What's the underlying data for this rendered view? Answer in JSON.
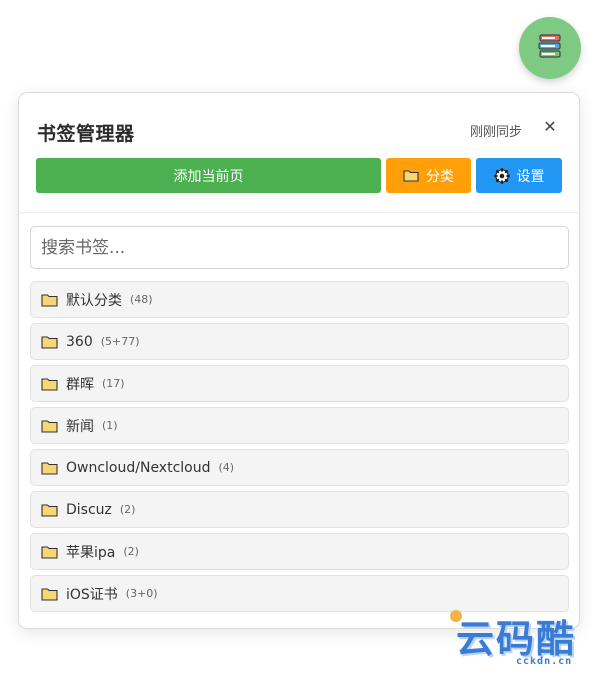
{
  "header": {
    "title": "书签管理器",
    "sync_status": "刚刚同步",
    "close_label": "✕"
  },
  "toolbar": {
    "add_label": "添加当前页",
    "category_label": "分类",
    "settings_label": "设置"
  },
  "search": {
    "placeholder": "搜索书签..."
  },
  "categories": [
    {
      "name": "默认分类",
      "count": "(48)"
    },
    {
      "name": "360",
      "count": "(5+77)"
    },
    {
      "name": "群晖",
      "count": "(17)"
    },
    {
      "name": "新闻",
      "count": "(1)"
    },
    {
      "name": "Owncloud/Nextcloud",
      "count": "(4)"
    },
    {
      "name": "Discuz",
      "count": "(2)"
    },
    {
      "name": "苹果ipa",
      "count": "(2)"
    },
    {
      "name": "iOS证书",
      "count": "(3+0)"
    }
  ],
  "watermark": {
    "text": "云码酷",
    "domain": "cckdn.cn"
  },
  "colors": {
    "accent_green": "#4caf50",
    "accent_orange": "#ff9f0a",
    "accent_blue": "#2196f3",
    "fab_green": "#7fca83",
    "folder_yellow": "#f7d774"
  },
  "icons": {
    "fab": "books-icon",
    "category_button": "folder-icon",
    "settings_button": "gear-icon",
    "list_item": "folder-icon"
  }
}
